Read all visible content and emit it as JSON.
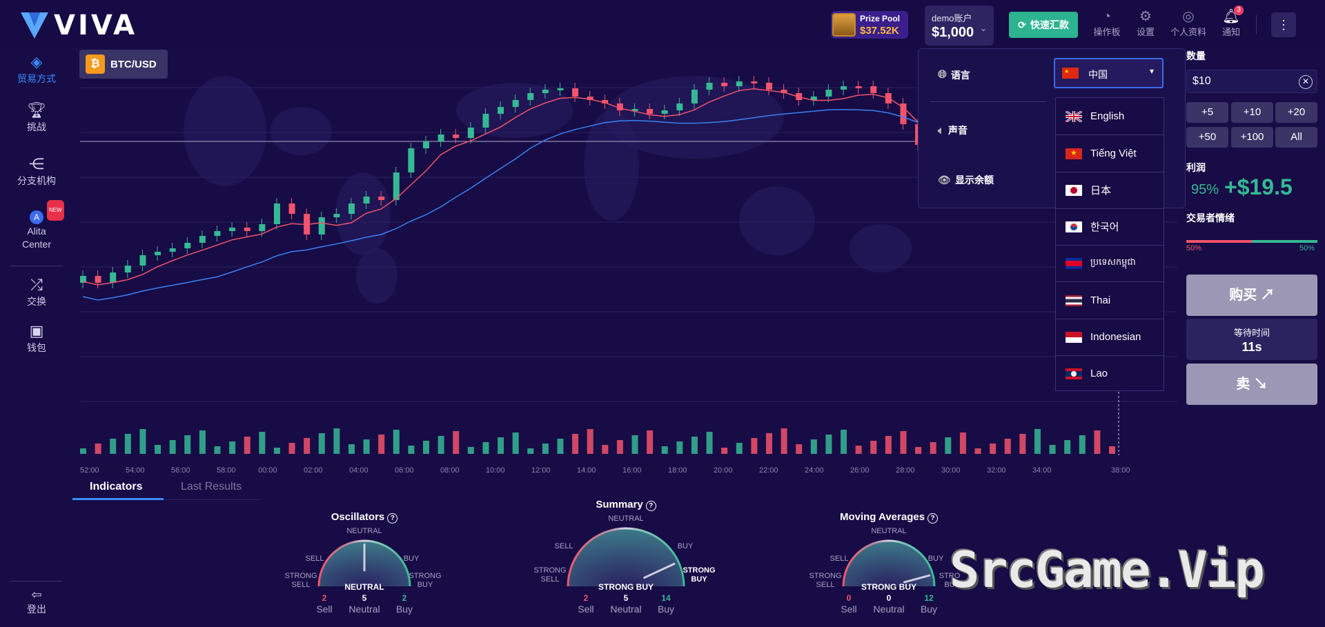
{
  "brand": {
    "name": "VIVA"
  },
  "header": {
    "prize_pool": {
      "label": "Prize Pool",
      "value": "$37.52K"
    },
    "account": {
      "type": "demo账户",
      "balance": "$1,000"
    },
    "deposit_label": "快速汇款",
    "icons": [
      {
        "label": "操作板",
        "icon": "dashboard-icon"
      },
      {
        "label": "设置",
        "icon": "gear-icon"
      },
      {
        "label": "个人资料",
        "icon": "profile-icon"
      },
      {
        "label": "通知",
        "icon": "bell-icon",
        "badge": "3"
      }
    ]
  },
  "sidebar": {
    "items": [
      {
        "label": "贸易方式",
        "icon": "trade-icon",
        "active": true
      },
      {
        "label": "挑战",
        "icon": "trophy-icon"
      },
      {
        "label": "分支机构",
        "icon": "share-icon"
      },
      {
        "label": "Alita Center",
        "icon": "alita-icon",
        "badge": "NEW"
      },
      {
        "label": "交换",
        "icon": "shuffle-icon"
      },
      {
        "label": "钱包",
        "icon": "wallet-icon"
      }
    ],
    "logout": "登出"
  },
  "chart": {
    "pair": "BTC/USD",
    "coin_symbol": "₿",
    "time_labels": [
      "52:00",
      "54:00",
      "56:00",
      "58:00",
      "00:00",
      "02:00",
      "04:00",
      "06:00",
      "08:00",
      "10:00",
      "12:00",
      "14:00",
      "16:00",
      "18:00",
      "20:00",
      "22:00",
      "24:00",
      "26:00",
      "28:00",
      "30:00",
      "32:00",
      "34:00",
      "38:00"
    ]
  },
  "bottom_tabs": {
    "active": "Indicators",
    "inactive": "Last Results"
  },
  "gauges": [
    {
      "title": "Oscillators",
      "verdict": "NEUTRAL",
      "labels": {
        "neutral": "NEUTRAL",
        "sell": "SELL",
        "buy": "BUY",
        "strong_sell": "STRONG SELL",
        "strong_buy": "STRONG BUY"
      },
      "sell": "2",
      "neutral": "5",
      "buy": "2",
      "sell_label": "Sell",
      "neutral_label": "Neutral",
      "buy_label": "Buy"
    },
    {
      "title": "Summary",
      "verdict": "STRONG BUY",
      "labels": {
        "neutral": "NEUTRAL",
        "sell": "SELL",
        "buy": "BUY",
        "strong_sell": "STRONG SELL",
        "strong_buy": "STRONG BUY"
      },
      "sell": "2",
      "neutral": "5",
      "buy": "14",
      "sell_label": "Sell",
      "neutral_label": "Neutral",
      "buy_label": "Buy"
    },
    {
      "title": "Moving Averages",
      "verdict": "STRONG BUY",
      "labels": {
        "neutral": "NEUTRAL",
        "sell": "SELL",
        "buy": "BUY",
        "strong_sell": "STRONG SELL",
        "strong_buy": "STRO BU"
      },
      "sell": "0",
      "neutral": "0",
      "buy": "12",
      "sell_label": "Sell",
      "neutral_label": "Neutral",
      "buy_label": "Buy"
    }
  ],
  "trade_panel": {
    "quantity_label": "数量",
    "amount": "$10",
    "quick_amounts": [
      "+5",
      "+10",
      "+20",
      "+50",
      "+100",
      "All"
    ],
    "profit_label": "利润",
    "profit_pct": "95%",
    "profit_value": "+$19.5",
    "sentiment_label": "交易者情绪",
    "sentiment_sell": "50%",
    "sentiment_buy": "50%",
    "buy_label": "购买",
    "wait_label": "等待时间",
    "wait_value": "11s",
    "sell_label": "卖"
  },
  "settings_popup": {
    "language_label": "语言",
    "selected_language": "中国",
    "sound_label": "声音",
    "show_balance_label": "显示余额",
    "languages": [
      "English",
      "Tiếng Việt",
      "日本",
      "한국어",
      "ប្រទេសកម្ពុជា",
      "Thai",
      "Indonesian",
      "Lao"
    ]
  },
  "watermark": "SrcGame.Vip",
  "colors": {
    "up": "#35b995",
    "down": "#f2546b",
    "accent": "#3b8cff",
    "bg": "#170c45"
  }
}
